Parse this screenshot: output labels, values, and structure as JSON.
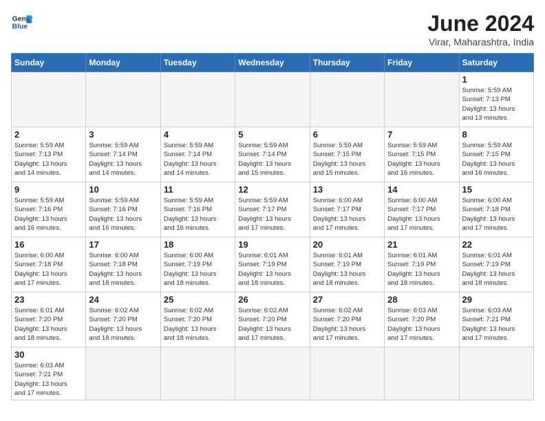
{
  "logo": {
    "line1": "General",
    "line2": "Blue"
  },
  "title": "June 2024",
  "subtitle": "Virar, Maharashtra, India",
  "days_of_week": [
    "Sunday",
    "Monday",
    "Tuesday",
    "Wednesday",
    "Thursday",
    "Friday",
    "Saturday"
  ],
  "weeks": [
    [
      {
        "day": "",
        "info": ""
      },
      {
        "day": "",
        "info": ""
      },
      {
        "day": "",
        "info": ""
      },
      {
        "day": "",
        "info": ""
      },
      {
        "day": "",
        "info": ""
      },
      {
        "day": "",
        "info": ""
      },
      {
        "day": "1",
        "info": "Sunrise: 5:59 AM\nSunset: 7:13 PM\nDaylight: 13 hours\nand 13 minutes."
      }
    ],
    [
      {
        "day": "2",
        "info": "Sunrise: 5:59 AM\nSunset: 7:13 PM\nDaylight: 13 hours\nand 14 minutes."
      },
      {
        "day": "3",
        "info": "Sunrise: 5:59 AM\nSunset: 7:14 PM\nDaylight: 13 hours\nand 14 minutes."
      },
      {
        "day": "4",
        "info": "Sunrise: 5:59 AM\nSunset: 7:14 PM\nDaylight: 13 hours\nand 14 minutes."
      },
      {
        "day": "5",
        "info": "Sunrise: 5:59 AM\nSunset: 7:14 PM\nDaylight: 13 hours\nand 15 minutes."
      },
      {
        "day": "6",
        "info": "Sunrise: 5:59 AM\nSunset: 7:15 PM\nDaylight: 13 hours\nand 15 minutes."
      },
      {
        "day": "7",
        "info": "Sunrise: 5:59 AM\nSunset: 7:15 PM\nDaylight: 13 hours\nand 16 minutes."
      },
      {
        "day": "8",
        "info": "Sunrise: 5:59 AM\nSunset: 7:15 PM\nDaylight: 13 hours\nand 16 minutes."
      }
    ],
    [
      {
        "day": "9",
        "info": "Sunrise: 5:59 AM\nSunset: 7:16 PM\nDaylight: 13 hours\nand 16 minutes."
      },
      {
        "day": "10",
        "info": "Sunrise: 5:59 AM\nSunset: 7:16 PM\nDaylight: 13 hours\nand 16 minutes."
      },
      {
        "day": "11",
        "info": "Sunrise: 5:59 AM\nSunset: 7:16 PM\nDaylight: 13 hours\nand 16 minutes."
      },
      {
        "day": "12",
        "info": "Sunrise: 5:59 AM\nSunset: 7:17 PM\nDaylight: 13 hours\nand 17 minutes."
      },
      {
        "day": "13",
        "info": "Sunrise: 6:00 AM\nSunset: 7:17 PM\nDaylight: 13 hours\nand 17 minutes."
      },
      {
        "day": "14",
        "info": "Sunrise: 6:00 AM\nSunset: 7:17 PM\nDaylight: 13 hours\nand 17 minutes."
      },
      {
        "day": "15",
        "info": "Sunrise: 6:00 AM\nSunset: 7:18 PM\nDaylight: 13 hours\nand 17 minutes."
      }
    ],
    [
      {
        "day": "16",
        "info": "Sunrise: 6:00 AM\nSunset: 7:18 PM\nDaylight: 13 hours\nand 17 minutes."
      },
      {
        "day": "17",
        "info": "Sunrise: 6:00 AM\nSunset: 7:18 PM\nDaylight: 13 hours\nand 18 minutes."
      },
      {
        "day": "18",
        "info": "Sunrise: 6:00 AM\nSunset: 7:19 PM\nDaylight: 13 hours\nand 18 minutes."
      },
      {
        "day": "19",
        "info": "Sunrise: 6:01 AM\nSunset: 7:19 PM\nDaylight: 13 hours\nand 18 minutes."
      },
      {
        "day": "20",
        "info": "Sunrise: 6:01 AM\nSunset: 7:19 PM\nDaylight: 13 hours\nand 18 minutes."
      },
      {
        "day": "21",
        "info": "Sunrise: 6:01 AM\nSunset: 7:19 PM\nDaylight: 13 hours\nand 18 minutes."
      },
      {
        "day": "22",
        "info": "Sunrise: 6:01 AM\nSunset: 7:19 PM\nDaylight: 13 hours\nand 18 minutes."
      }
    ],
    [
      {
        "day": "23",
        "info": "Sunrise: 6:01 AM\nSunset: 7:20 PM\nDaylight: 13 hours\nand 18 minutes."
      },
      {
        "day": "24",
        "info": "Sunrise: 6:02 AM\nSunset: 7:20 PM\nDaylight: 13 hours\nand 18 minutes."
      },
      {
        "day": "25",
        "info": "Sunrise: 6:02 AM\nSunset: 7:20 PM\nDaylight: 13 hours\nand 18 minutes."
      },
      {
        "day": "26",
        "info": "Sunrise: 6:02 AM\nSunset: 7:20 PM\nDaylight: 13 hours\nand 17 minutes."
      },
      {
        "day": "27",
        "info": "Sunrise: 6:02 AM\nSunset: 7:20 PM\nDaylight: 13 hours\nand 17 minutes."
      },
      {
        "day": "28",
        "info": "Sunrise: 6:03 AM\nSunset: 7:20 PM\nDaylight: 13 hours\nand 17 minutes."
      },
      {
        "day": "29",
        "info": "Sunrise: 6:03 AM\nSunset: 7:21 PM\nDaylight: 13 hours\nand 17 minutes."
      }
    ],
    [
      {
        "day": "30",
        "info": "Sunrise: 6:03 AM\nSunset: 7:21 PM\nDaylight: 13 hours\nand 17 minutes."
      },
      {
        "day": "",
        "info": ""
      },
      {
        "day": "",
        "info": ""
      },
      {
        "day": "",
        "info": ""
      },
      {
        "day": "",
        "info": ""
      },
      {
        "day": "",
        "info": ""
      },
      {
        "day": "",
        "info": ""
      }
    ]
  ]
}
